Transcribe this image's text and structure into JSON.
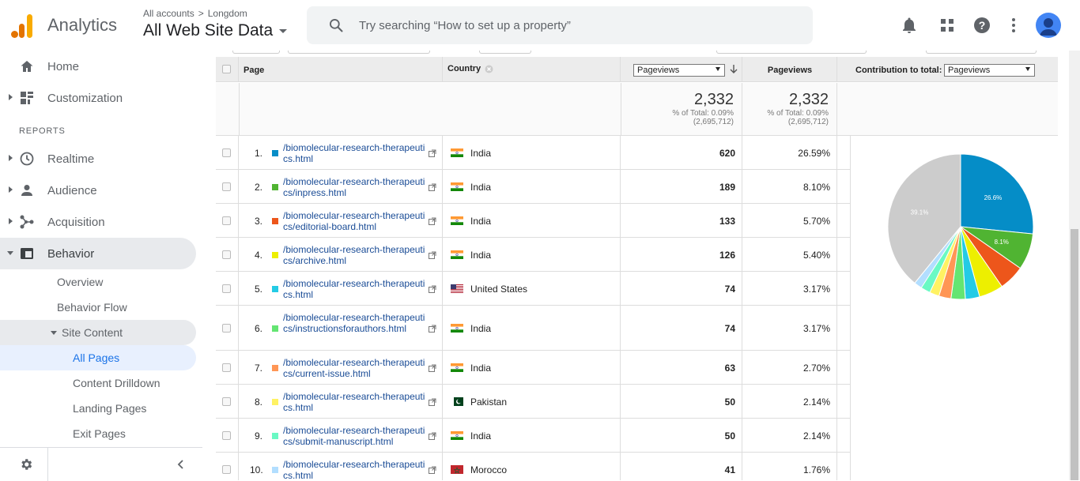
{
  "header": {
    "app_name": "Analytics",
    "breadcrumb": [
      "All accounts",
      "Longdom"
    ],
    "breadcrumb_sep": ">",
    "property": "All Web Site Data",
    "search_placeholder": "Try searching “How to set up a property”"
  },
  "sidebar": {
    "top_items": [
      {
        "label": "Home",
        "icon": "home-icon"
      },
      {
        "label": "Customization",
        "icon": "customization-icon"
      }
    ],
    "reports_label": "REPORTS",
    "report_items": [
      {
        "label": "Realtime",
        "icon": "clock-icon"
      },
      {
        "label": "Audience",
        "icon": "person-icon"
      },
      {
        "label": "Acquisition",
        "icon": "acquisition-icon"
      },
      {
        "label": "Behavior",
        "icon": "behavior-icon"
      }
    ],
    "behavior_sub": [
      "Overview",
      "Behavior Flow",
      "Site Content"
    ],
    "site_content_sub": [
      "All Pages",
      "Content Drilldown",
      "Landing Pages",
      "Exit Pages"
    ]
  },
  "table": {
    "col_page": "Page",
    "col_country": "Country",
    "metric_select": "Pageviews",
    "col_pageviews": "Pageviews",
    "contribution_label": "Contribution to total:",
    "contribution_select": "Pageviews",
    "summary": {
      "total": "2,332",
      "pct_line": "% of Total: 0.09%",
      "grand_total": "(2,695,712)"
    },
    "rows": [
      {
        "n": "1.",
        "page": "/biomolecular-research-therapeutics.html",
        "country": "India",
        "flag": "india",
        "views": "620",
        "pct": "26.59%",
        "color": "#058dc7"
      },
      {
        "n": "2.",
        "page": "/biomolecular-research-therapeutics/inpress.html",
        "country": "India",
        "flag": "india",
        "views": "189",
        "pct": "8.10%",
        "color": "#50b432"
      },
      {
        "n": "3.",
        "page": "/biomolecular-research-therapeutics/editorial-board.html",
        "country": "India",
        "flag": "india",
        "views": "133",
        "pct": "5.70%",
        "color": "#ed561b"
      },
      {
        "n": "4.",
        "page": "/biomolecular-research-therapeutics/archive.html",
        "country": "India",
        "flag": "india",
        "views": "126",
        "pct": "5.40%",
        "color": "#edef00"
      },
      {
        "n": "5.",
        "page": "/biomolecular-research-therapeutics.html",
        "country": "United States",
        "flag": "us",
        "views": "74",
        "pct": "3.17%",
        "color": "#24cbe5"
      },
      {
        "n": "6.",
        "page": "/biomolecular-research-therapeutics/instructionsforauthors.html",
        "country": "India",
        "flag": "india",
        "views": "74",
        "pct": "3.17%",
        "color": "#64e572"
      },
      {
        "n": "7.",
        "page": "/biomolecular-research-therapeutics/current-issue.html",
        "country": "India",
        "flag": "india",
        "views": "63",
        "pct": "2.70%",
        "color": "#ff9655"
      },
      {
        "n": "8.",
        "page": "/biomolecular-research-therapeutics.html",
        "country": "Pakistan",
        "flag": "pakistan",
        "views": "50",
        "pct": "2.14%",
        "color": "#fff263"
      },
      {
        "n": "9.",
        "page": "/biomolecular-research-therapeutics/submit-manuscript.html",
        "country": "India",
        "flag": "india",
        "views": "50",
        "pct": "2.14%",
        "color": "#6af9c4"
      },
      {
        "n": "10.",
        "page": "/biomolecular-research-therapeutics.html",
        "country": "Morocco",
        "flag": "morocco",
        "views": "41",
        "pct": "1.76%",
        "color": "#b2deff"
      }
    ]
  },
  "chart_data": {
    "type": "pie",
    "slices": [
      {
        "label": "1",
        "value": 26.59,
        "color": "#058dc7",
        "shown_label": "26.6%"
      },
      {
        "label": "2",
        "value": 8.1,
        "color": "#50b432",
        "shown_label": "8.1%"
      },
      {
        "label": "3",
        "value": 5.7,
        "color": "#ed561b"
      },
      {
        "label": "4",
        "value": 5.4,
        "color": "#edef00"
      },
      {
        "label": "5",
        "value": 3.17,
        "color": "#24cbe5"
      },
      {
        "label": "6",
        "value": 3.17,
        "color": "#64e572"
      },
      {
        "label": "7",
        "value": 2.7,
        "color": "#ff9655"
      },
      {
        "label": "8",
        "value": 2.14,
        "color": "#fff263"
      },
      {
        "label": "9",
        "value": 2.14,
        "color": "#6af9c4"
      },
      {
        "label": "10",
        "value": 1.76,
        "color": "#b2deff"
      },
      {
        "label": "other",
        "value": 39.13,
        "color": "#cccccc",
        "shown_label": "39.1%"
      }
    ]
  }
}
